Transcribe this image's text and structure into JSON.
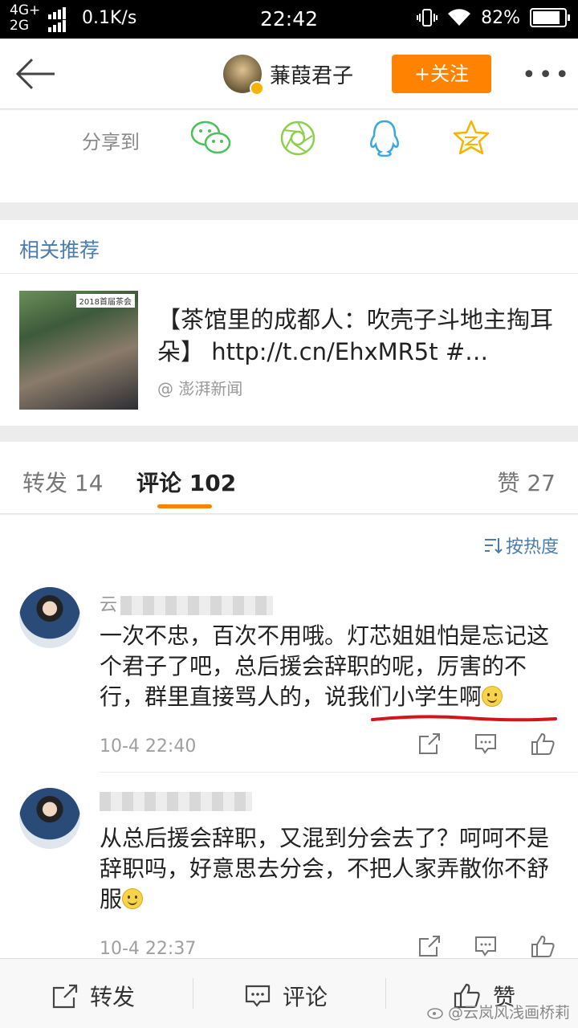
{
  "status_bar": {
    "network_top": "4G+",
    "network_bottom": "2G",
    "speed": "0.1K/s",
    "time": "22:42",
    "battery": "82%",
    "battery_level": 0.82
  },
  "header": {
    "user_name": "蒹葭君子",
    "follow_label": "+关注"
  },
  "share": {
    "label": "分享到",
    "targets": [
      "wechat-icon",
      "moments-icon",
      "qq-icon",
      "qzone-icon"
    ]
  },
  "recommend": {
    "title": "相关推荐",
    "thumb_tag": "2018首届茶会",
    "text": "【茶馆里的成都人：吹壳子斗地主掏耳朵】 http://t.cn/EhxMR5t #…",
    "source": "@ 澎湃新闻"
  },
  "tabs": {
    "repost": "转发 14",
    "comment": "评论 102",
    "like": "赞 27"
  },
  "sort_label": "按热度",
  "comments": [
    {
      "name_prefix": "云",
      "text_before": "一次不忠，百次不用哦。灯芯姐姐怕是忘记这个君子了吧，总后援会辞职的呢，厉害的不行，群里直接骂人的，",
      "text_highlight": "说我们小学生啊",
      "time": "10-4 22:40"
    },
    {
      "name_prefix": "",
      "text": "从总后援会辞职，又混到分会去了？呵呵不是辞职吗，好意思去分会，不把人家弄散你不舒服",
      "time": "10-4 22:37"
    }
  ],
  "bottom_bar": {
    "repost": "转发",
    "comment": "评论",
    "like": "赞"
  },
  "watermark": "@云岚风浅画桥莉",
  "colors": {
    "accent_orange": "#ff8200",
    "link_blue": "#4a7dab",
    "annotation_red": "#d0161b"
  }
}
